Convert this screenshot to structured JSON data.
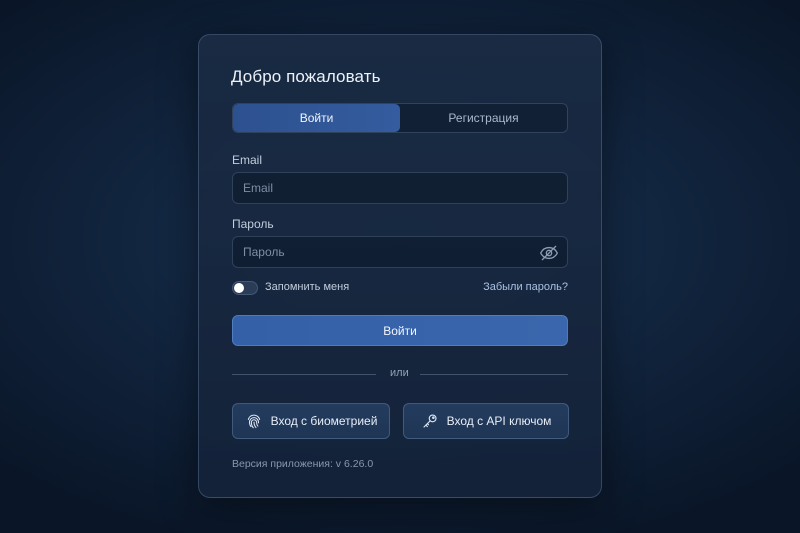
{
  "card": {
    "title": "Добро пожаловать"
  },
  "tabs": [
    {
      "label": "Войти",
      "active": true
    },
    {
      "label": "Регистрация",
      "active": false
    }
  ],
  "email": {
    "label": "Email",
    "placeholder": "Email",
    "value": ""
  },
  "password": {
    "label": "Пароль",
    "placeholder": "Пароль",
    "value": "",
    "toggle_icon": "eye-off-icon"
  },
  "remember": {
    "label": "Запомнить меня",
    "checked": false
  },
  "forgot_label": "Забыли пароль?",
  "submit_label": "Войти",
  "divider_label": "или",
  "biometric": {
    "label": "Вход с биометрией",
    "icon": "fingerprint-icon"
  },
  "api_key": {
    "label": "Вход с API ключом",
    "icon": "key-icon"
  },
  "version_text": "Версия приложения: v 6.26.0",
  "colors": {
    "accent": "#345c9e",
    "background": "#122640",
    "card": "#1a2b44",
    "link": "#a9c1e4"
  }
}
